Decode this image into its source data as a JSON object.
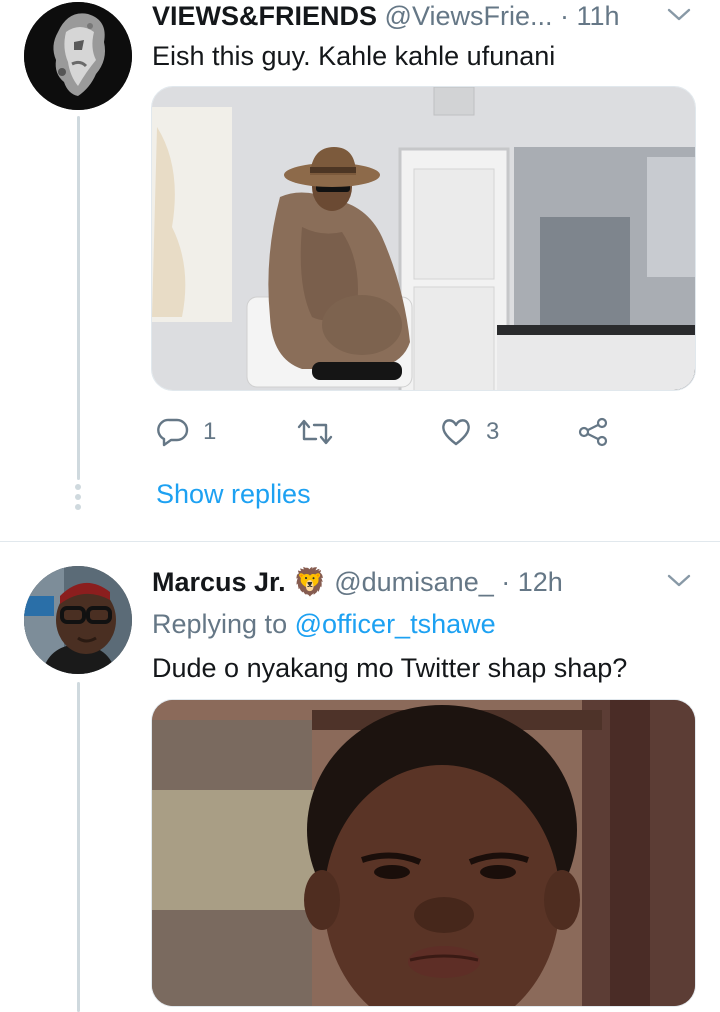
{
  "tweet1": {
    "display_name": "VIEWS&FRIENDS",
    "handle": "@ViewsFrie...",
    "time": "· 11h",
    "text": "Eish this guy. Kahle kahle ufunani",
    "reply_count": "1",
    "retweet_count": "",
    "like_count": "3",
    "show_replies": "Show replies",
    "icons": [
      "reply-icon",
      "retweet-icon",
      "like-icon",
      "share-icon",
      "chevron-down-icon"
    ]
  },
  "tweet2": {
    "display_name": "Marcus Jr.",
    "emoji": "🦁",
    "handle": "@dumisane_",
    "time": "· 12h",
    "replying_prefix": "Replying to",
    "replying_to": "@officer_tshawe",
    "text": "Dude o nyakang mo Twitter shap shap?"
  },
  "colors": {
    "link": "#1da1f2",
    "secondary": "#657786",
    "thread_line": "#cfd9de",
    "divider": "#e1e8ed"
  }
}
